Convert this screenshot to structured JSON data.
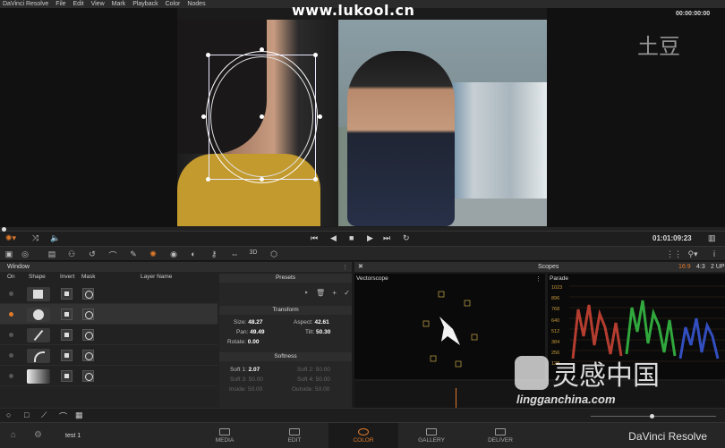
{
  "menubar": {
    "app": "DaVinci Resolve",
    "items": [
      "File",
      "Edit",
      "View",
      "Mark",
      "Playback",
      "Color",
      "Nodes"
    ],
    "timecode": "00:00:00:00"
  },
  "watermarks": {
    "top": "www.lukool.cn",
    "tudou": "土豆",
    "brand_cn": "灵感中国",
    "brand_url": "lingganchina.com"
  },
  "transport": {
    "timecode": "01:01:09:23"
  },
  "window_panel": {
    "title": "Window",
    "columns": [
      "On",
      "Shape",
      "Invert",
      "Mask",
      "Layer Name"
    ]
  },
  "presets": {
    "title": "Presets",
    "transform_title": "Transform",
    "size_label": "Size:",
    "size_value": "48.27",
    "aspect_label": "Aspect:",
    "aspect_value": "42.61",
    "pan_label": "Pan:",
    "pan_value": "49.49",
    "tilt_label": "Tilt:",
    "tilt_value": "50.30",
    "rotate_label": "Rotate:",
    "rotate_value": "0.00",
    "softness_title": "Softness",
    "soft1_label": "Soft 1:",
    "soft1_value": "2.07",
    "soft2_label": "Soft 2:",
    "soft2_value": "50.00",
    "soft3_label": "Soft 3:",
    "soft3_value": "50.00",
    "soft4_label": "Soft 4:",
    "soft4_value": "50.00",
    "inside_label": "Inside:",
    "inside_value": "50.00",
    "outside_label": "Outside:",
    "outside_value": "50.00"
  },
  "scopes": {
    "title": "Scopes",
    "mode1": "16:9",
    "mode2": "4:3",
    "mode3": "2 UP",
    "vectorscope": "Vectorscope",
    "parade": "Parade",
    "parade_ticks": [
      "1023",
      "896",
      "768",
      "640",
      "512",
      "384",
      "256",
      "128"
    ]
  },
  "footer": {
    "project": "test 1",
    "pages": [
      "MEDIA",
      "EDIT",
      "COLOR",
      "GALLERY",
      "DELIVER"
    ],
    "brand": "DaVinci Resolve"
  },
  "colors": {
    "accent": "#e07a2a"
  }
}
